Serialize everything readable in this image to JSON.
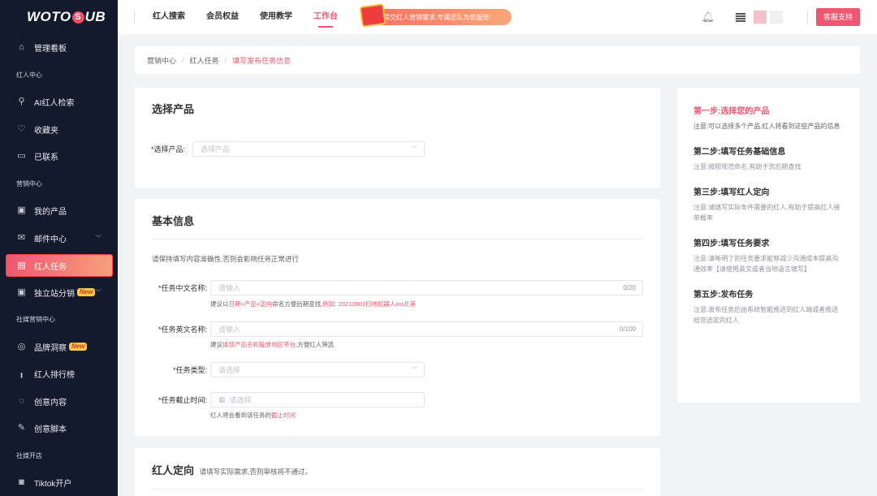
{
  "logo": {
    "left": "WOTO",
    "mark": "S",
    "right": "UB"
  },
  "sidebar": {
    "items": [
      {
        "type": "item",
        "label": "管理看板",
        "icon": "home-icon",
        "glyph": "⌂"
      },
      {
        "type": "section",
        "label": "红人中心"
      },
      {
        "type": "item",
        "label": "AI红人检索",
        "icon": "user-search-icon",
        "glyph": "⚲"
      },
      {
        "type": "item",
        "label": "收藏夹",
        "icon": "heart-icon",
        "glyph": "♡"
      },
      {
        "type": "item",
        "label": "已联系",
        "icon": "chat-icon",
        "glyph": "▭"
      },
      {
        "type": "section",
        "label": "营销中心"
      },
      {
        "type": "item",
        "label": "我的产品",
        "icon": "product-icon",
        "glyph": "▣"
      },
      {
        "type": "item",
        "label": "邮件中心",
        "icon": "mail-icon",
        "glyph": "✉",
        "chevron": true
      },
      {
        "type": "item",
        "label": "红人任务",
        "icon": "task-icon",
        "glyph": "▤",
        "active": true
      },
      {
        "type": "item",
        "label": "独立站分销",
        "icon": "store-icon",
        "glyph": "▣",
        "badge": "New",
        "chevron": true
      },
      {
        "type": "section",
        "label": "社媒营销中心"
      },
      {
        "type": "item",
        "label": "品牌洞察",
        "icon": "insight-icon",
        "glyph": "◎",
        "badge": "New"
      },
      {
        "type": "item",
        "label": "红人排行榜",
        "icon": "ranking-icon",
        "glyph": "╻"
      },
      {
        "type": "item",
        "label": "创意内容",
        "icon": "palette-icon",
        "glyph": "◌"
      },
      {
        "type": "item",
        "label": "创意脚本",
        "icon": "pen-icon",
        "glyph": "✎"
      },
      {
        "type": "section",
        "label": "社媒开店"
      },
      {
        "type": "item",
        "label": "Tiktok开户",
        "icon": "tiktok-icon",
        "glyph": "◙"
      }
    ]
  },
  "topbar": {
    "nav": [
      "红人搜索",
      "会员权益",
      "使用教学",
      "工作台"
    ],
    "active_nav": 3,
    "promo": "提交红人营销需求,专属团队为您服务!",
    "support_button": "客服支持"
  },
  "breadcrumb": [
    "营销中心",
    "红人任务",
    "填写发布任务信息"
  ],
  "product_card": {
    "title": "选择产品",
    "field_label": "*选择产品:",
    "field_placeholder": "选择产品"
  },
  "basic_card": {
    "title": "基本信息",
    "notice": "请保持填写内容准确性,否则会影响任务正常进行",
    "cn_name": {
      "label": "*任务中文名称:",
      "placeholder": "请输入",
      "count": "0/20",
      "hint_pre": "建议以",
      "hint_red": "日期+产品+定向",
      "hint_mid": "命名方便后期查找,",
      "hint_red2": "例如: 20210903扫地机器人ins北美"
    },
    "en_name": {
      "label": "*任务英文名称:",
      "placeholder": "请输入",
      "count": "0/100",
      "hint_pre": "建议",
      "hint_red": "体现产品名和投放地区平台",
      "hint_mid": ",方便红人筛选"
    },
    "task_type": {
      "label": "*任务类型:",
      "placeholder": "请选择"
    },
    "deadline": {
      "label": "*任务截止时间:",
      "placeholder": "请选择",
      "hint_pre": "红人将会看到该任务的",
      "hint_red": "截止时间"
    }
  },
  "targeting_card": {
    "title": "红人定向",
    "subtitle": "请填写实际需求,否则审核将不通过。"
  },
  "steps": [
    {
      "title": "第一步:选择您的产品",
      "note": "注意:可以选择多个产品,红人将看到这些产品的信息",
      "active": true
    },
    {
      "title": "第二步:填写任务基础信息",
      "note": "注意:按照规范命名,有助于您后期查找"
    },
    {
      "title": "第三步:填写红人定向",
      "note": "注意:请填写实际条件需要的红人,有助于提高红人接单概率"
    },
    {
      "title": "第四步:填写任务要求",
      "note": "注意:清晰明了的任务要求能够减少沟通成本提高沟通效率【请使用英文或者当地语言填写】"
    },
    {
      "title": "第五步:发布任务",
      "note": "注意:发布任务后由系统智能推送到红人端或者推送给您选定的红人"
    }
  ],
  "colors": {
    "accent": "#f0566f",
    "sidebar_bg": "#131a2c",
    "page_bg": "#f2f3f5"
  }
}
